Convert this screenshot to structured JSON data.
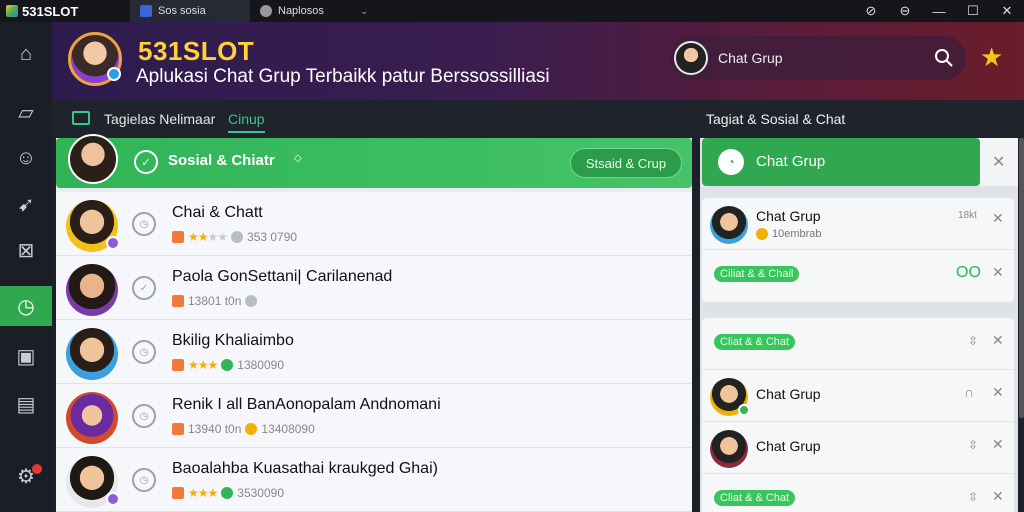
{
  "titlebar": {
    "app_name": "531SLOT",
    "tabs": [
      {
        "label": "Sos sosia"
      },
      {
        "label": "Naplosos"
      }
    ],
    "controls": [
      "⊘",
      "⊖",
      "—",
      "☐",
      "✕"
    ]
  },
  "sidebar": {
    "items": [
      {
        "icon": "home-icon",
        "glyph": "⌂"
      },
      {
        "icon": "edit-icon",
        "glyph": "▱"
      },
      {
        "icon": "user-icon",
        "glyph": "☺"
      },
      {
        "icon": "pin-icon",
        "glyph": "➹"
      },
      {
        "icon": "inbox-icon",
        "glyph": "⊠"
      },
      {
        "icon": "clock-icon",
        "glyph": "◷",
        "active": true
      },
      {
        "icon": "note-icon",
        "glyph": "▣"
      },
      {
        "icon": "bag-icon",
        "glyph": "▤"
      },
      {
        "icon": "settings-icon",
        "glyph": "⚙"
      }
    ]
  },
  "header": {
    "title": "531SLOT",
    "subtitle": "Aplukasi Chat Grup Terbaikk patur Berssossilliasi",
    "search_label": "Chat Grup"
  },
  "subnav": {
    "tab1": "Tagielas Nelimaar",
    "tab2": "Cinup",
    "right": "Tagiat & Sosial & Chat"
  },
  "main": {
    "bar_label": "Sosial & Chiatr",
    "bar_button": "Stsaid & Crup",
    "rows": [
      {
        "name": "Chai & Chatt",
        "meta": "353 0790",
        "stars": 2
      },
      {
        "name": "Paola GonSettani| Carilanenad",
        "meta": "13801 t0n",
        "stars": 0
      },
      {
        "name": "Bkilig Khaliaimbo",
        "meta": "1380090",
        "stars": 3
      },
      {
        "name": "Renik I all BanAonopalam Andnomani",
        "meta": "13940 t0n",
        "meta2": "13408090",
        "stars": 0
      },
      {
        "name": "Baoalahba Kuasathai kraukged Ghai)",
        "meta": "3530090",
        "stars": 3
      }
    ]
  },
  "right_panel": {
    "header_label": "Chat Grup",
    "card1": {
      "name": "Chat Grup",
      "sub": "10embrab",
      "time": "18kt",
      "pill": "Ciliat & & Chail",
      "count": "OO"
    },
    "card2": {
      "pill1": "Cliat & & Chat",
      "row1_name": "Chat Grup",
      "row2_name": "Chat Grup",
      "pill2": "Cliat & & Chat"
    }
  },
  "colors": {
    "accent": "#2fa84f",
    "brand": "#ffd23a",
    "header_start": "#2e1b4e",
    "header_end": "#6a1d2a"
  }
}
